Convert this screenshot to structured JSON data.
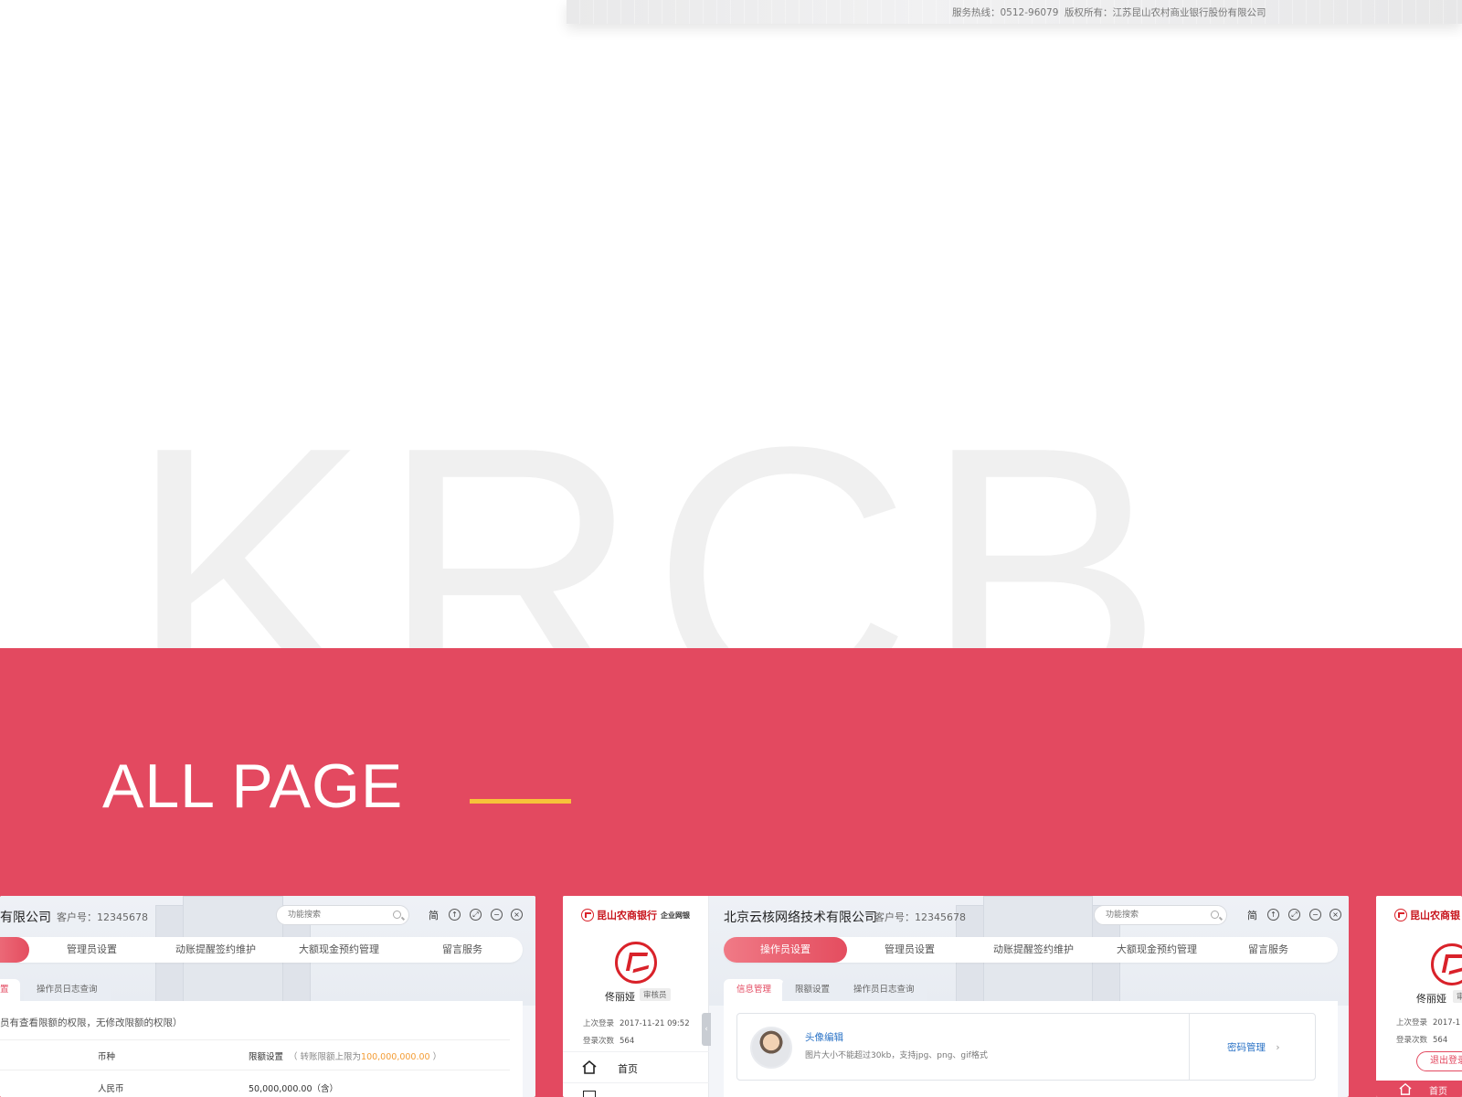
{
  "top_footer": {
    "hotline": "服务热线：0512-96079",
    "copyright": "版权所有：江苏昆山农村商业银行股份有限公司"
  },
  "watermark": "KRCB",
  "section": {
    "title": "ALL PAGE",
    "accent_color": "#e34960",
    "underline_color": "#f7c23a"
  },
  "screen1": {
    "company": "有限公司",
    "customer_no": "客户号：12345678",
    "search_placeholder": "功能搜索",
    "lang": "简",
    "nav": [
      "管理员设置",
      "动账提醒签约维护",
      "大额现金预约管理",
      "留言服务"
    ],
    "subtab_active": "置",
    "subtab": "操作员日志查询",
    "note": "员有查看限额的权限，无修改限额的权限）",
    "table": {
      "col_currency": "币种",
      "col_limit": "限额设置",
      "limit_hint_pre": "（ 转账限额上限为",
      "limit_hint_value": "100,000,000.00",
      "limit_hint_post": "）",
      "row_currency": "人民币",
      "row_limit": "50,000,000.00（含）"
    }
  },
  "screen2": {
    "bank_name": "昆山农商银行",
    "bank_sub": "企业网银",
    "user_name": "佟丽娅",
    "user_role": "审核员",
    "last_login_label": "上次登录",
    "last_login_value": "2017-11-21 09:52",
    "login_count_label": "登录次数",
    "login_count_value": "564",
    "menu_home": "首页",
    "company": "北京云核网络技术有限公司",
    "customer_no": "客户号：12345678",
    "search_placeholder": "功能搜索",
    "lang": "简",
    "nav_active": "操作员设置",
    "nav": [
      "管理员设置",
      "动账提醒签约维护",
      "大额现金预约管理",
      "留言服务"
    ],
    "subtabs": [
      "信息管理",
      "限额设置",
      "操作员日志查询"
    ],
    "card_title": "头像编辑",
    "card_desc": "图片大小不能超过30kb，支持jpg、png、gif格式",
    "card_link": "密码管理"
  },
  "screen3": {
    "bank_name": "昆山农商银",
    "user_name": "佟丽娅",
    "user_role": "审",
    "last_login_label": "上次登录",
    "last_login_value": "2017-1",
    "login_count_label": "登录次数",
    "login_count_value": "564",
    "logout": "退出登录",
    "menu_home": "首页"
  }
}
